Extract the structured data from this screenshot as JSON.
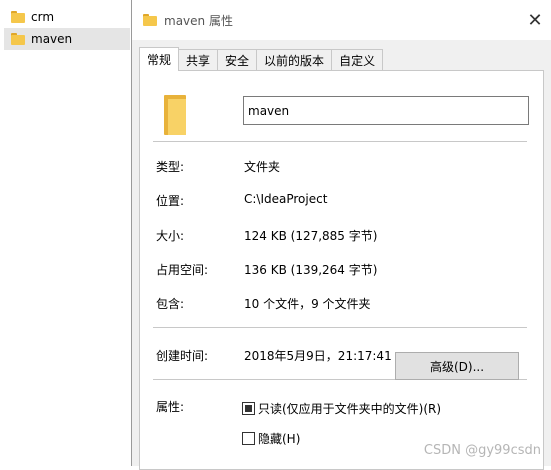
{
  "explorer": {
    "items": [
      {
        "label": "crm",
        "selected": false
      },
      {
        "label": "maven",
        "selected": true
      }
    ]
  },
  "dialog": {
    "title": "maven 属性",
    "close_glyph": "✕",
    "tabs": [
      {
        "label": "常规",
        "active": true
      },
      {
        "label": "共享",
        "active": false
      },
      {
        "label": "安全",
        "active": false
      },
      {
        "label": "以前的版本",
        "active": false
      },
      {
        "label": "自定义",
        "active": false
      }
    ],
    "name_value": "maven",
    "props": {
      "type": {
        "label": "类型:",
        "value": "文件夹"
      },
      "location": {
        "label": "位置:",
        "value": "C:\\IdeaProject"
      },
      "size": {
        "label": "大小:",
        "value": "124 KB (127,885 字节)"
      },
      "disk_size": {
        "label": "占用空间:",
        "value": "136 KB (139,264 字节)"
      },
      "contains": {
        "label": "包含:",
        "value": "10 个文件，9 个文件夹"
      },
      "created": {
        "label": "创建时间:",
        "value": "2018年5月9日，21:17:41"
      }
    },
    "attributes": {
      "label": "属性:",
      "readonly": {
        "label": "只读(仅应用于文件夹中的文件)(R)",
        "state": "indeterminate"
      },
      "hidden": {
        "label": "隐藏(H)",
        "state": "unchecked"
      },
      "advanced_button": "高级(D)..."
    }
  },
  "watermark": "CSDN @gy99csdn",
  "colors": {
    "folder_yellow": "#f5c74b",
    "dialog_bg": "#f0f0f0",
    "selection_bg": "#e5e5e5"
  }
}
